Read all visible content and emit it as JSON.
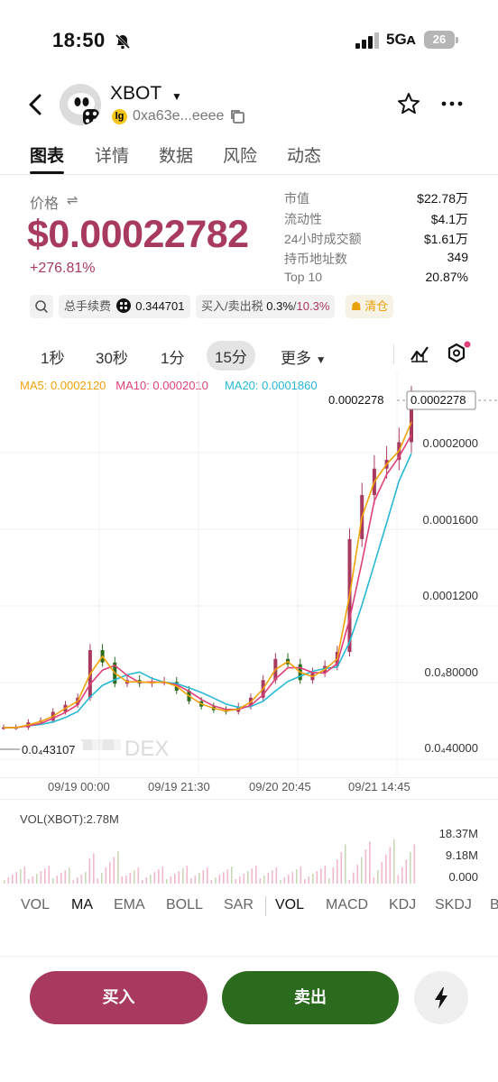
{
  "status": {
    "time": "18:50",
    "network": "5Gᴀ",
    "battery": "26"
  },
  "header": {
    "token_name": "XBOT",
    "chain_badge": "lg",
    "address": "0xa63e...eeee"
  },
  "tabs": [
    "图表",
    "详情",
    "数据",
    "风险",
    "动态"
  ],
  "price": {
    "label": "价格",
    "value": "$0.00022782",
    "change": "+276.81%",
    "color": "#a83a5f"
  },
  "stats": [
    {
      "k": "市值",
      "v": "$22.78万"
    },
    {
      "k": "流动性",
      "v": "$4.1万"
    },
    {
      "k": "24小时成交额",
      "v": "$1.61万"
    },
    {
      "k": "持币地址数",
      "v": "349"
    },
    {
      "k": "Top 10",
      "v": "20.87%"
    }
  ],
  "chips": {
    "fee_label": "总手续费",
    "fee_value": "0.344701",
    "tax_label": "买入/卖出税",
    "tax_buy": "0.3%",
    "tax_sep": "/",
    "tax_sell": "10.3%",
    "clear_label": "清仓"
  },
  "intervals": [
    "1秒",
    "30秒",
    "1分",
    "15分",
    "更多"
  ],
  "active_interval": "15分",
  "ma": {
    "ma5": "MA5: 0.0002120",
    "ma10": "MA10: 0.0002010",
    "ma20": "MA20: 0.0001860",
    "ma5_color": "#f0a30a",
    "ma10_color": "#e0407a",
    "ma20_color": "#27b8d4"
  },
  "chart_data": {
    "type": "candlestick",
    "y_labels": [
      "0.0002000",
      "0.0001600",
      "0.0001200",
      "0.0₄80000",
      "0.0₄40000"
    ],
    "current_price_label": "0.0002278",
    "current_price_tag": "0.0002278",
    "low_marker": "0.0₄43107",
    "x_labels": [
      "09/19 00:00",
      "09/19 21:30",
      "09/20 20:45",
      "09/21 14:45"
    ],
    "watermark": "DEX",
    "ylim": [
      2e-05,
      0.00024
    ],
    "close": [
      4.31e-05,
      4.31e-05,
      4.6e-05,
      4.7e-05,
      5.2e-05,
      5.6e-05,
      6e-05,
      8.7e-05,
      8e-05,
      6.8e-05,
      7e-05,
      6.8e-05,
      6.9e-05,
      6.9e-05,
      6.4e-05,
      5.8e-05,
      5.5e-05,
      5.3e-05,
      5.2e-05,
      5.5e-05,
      6e-05,
      7e-05,
      8.2e-05,
      7.9e-05,
      7e-05,
      7.4e-05,
      7.8e-05,
      8.6e-05,
      0.00015,
      0.000175,
      0.00019,
      0.000195,
      0.000205,
      0.0002278
    ]
  },
  "volume": {
    "label": "VOL(XBOT):2.78M",
    "axis": [
      "18.37M",
      "9.18M",
      "0.000"
    ]
  },
  "indicators": [
    "VOL",
    "MA",
    "EMA",
    "BOLL",
    "SAR",
    "VOL",
    "MACD",
    "KDJ",
    "SKDJ",
    "B"
  ],
  "actions": {
    "buy": "买入",
    "sell": "卖出"
  }
}
